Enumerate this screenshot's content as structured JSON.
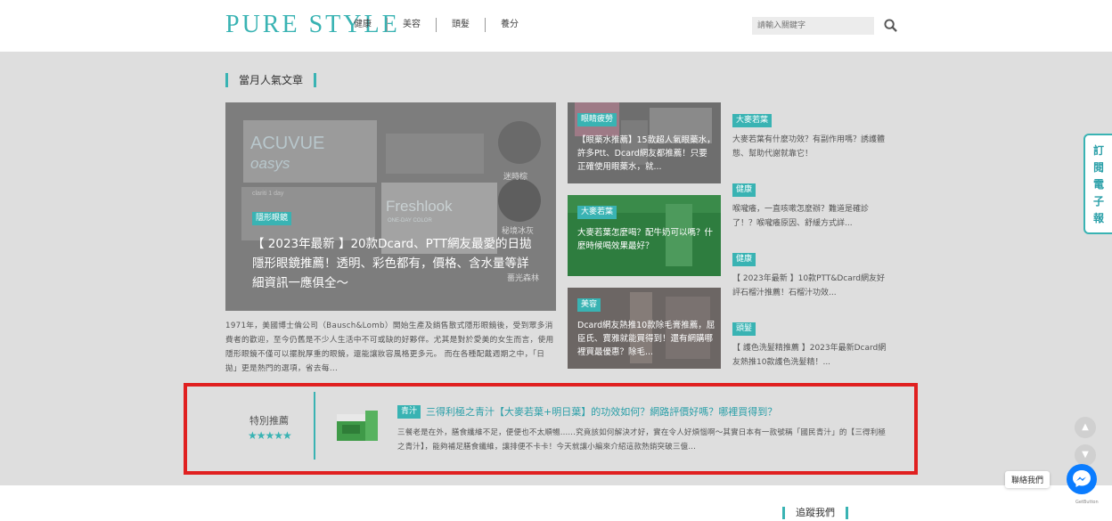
{
  "header": {
    "logo": "PURE STYLE",
    "nav": [
      "健康",
      "美容",
      "頭髮",
      "養分"
    ],
    "search_placeholder": "請輸入關鍵字"
  },
  "popular": {
    "title": "當月人氣文章",
    "hero": {
      "tag": "隱形眼鏡",
      "title": "【 2023年最新 】20款Dcard、PTT網友最愛的日拋隱形眼鏡推薦！透明、彩色都有，價格、含水量等詳細資訊一應俱全～",
      "image_text": [
        "ACUVUE",
        "oasys",
        "Freshlook",
        "ONE-DAY COLOR",
        "clariti 1 day",
        "迷時棕",
        "秘境冰灰",
        "薔光森林"
      ],
      "excerpt": "1971年，美國博士倫公司（Bausch&Lomb）開始生產及銷售散式隱形眼鏡後，受到眾多消費者的歡迎，至今仍舊是不少人生活中不可或缺的好夥伴。尤其是對於愛美的女生而言，使用隱形眼鏡不僅可以擺脫厚重的眼鏡，還能讓妝容風格更多元。 而在各種配戴週期之中，「日拋」更是熱門的選項，省去每..."
    },
    "cards": [
      {
        "tag": "眼睛疲勞",
        "title": "【眼藥水推薦】15款超人氣眼藥水，許多Ptt、Dcard網友都推薦！只要正確使用眼藥水，就..."
      },
      {
        "tag": "大麥若葉",
        "title": "大麥若葉怎麼喝？配牛奶可以嗎？什麼時候喝效果最好？"
      },
      {
        "tag": "美容",
        "title": "Dcard網友熱推10款除毛膏推薦，屈臣氏、寶雅就能買得到！還有網購哪裡買最優惠？除毛..."
      }
    ],
    "side": [
      {
        "tag": "大麥若葉",
        "title": "大麥若葉有什麼功效？有副作用嗎？誘護體態、幫助代謝就靠它！"
      },
      {
        "tag": "健康",
        "title": "喉嚨癢，一直咳嗽怎麼辦？難道是確診了！？喉嚨癢原因、舒緩方式詳..."
      },
      {
        "tag": "健康",
        "title": "【 2023年最新 】10款PTT&Dcard網友好評石榴汁推薦！石榴汁功效..."
      },
      {
        "tag": "頭髮",
        "title": "【 護色洗髮精推薦 】2023年最新Dcard網友熱推10款護色洗髮精！..."
      }
    ]
  },
  "recommend": {
    "label": "特別推薦",
    "stars": "★★★★★",
    "tag": "青汁",
    "title": "三得利極之青汁【大麥若葉+明日葉】的功效如何？網路評價好嗎？哪裡買得到？",
    "body": "三餐老是在外，膳食纖維不足，便便也不太順暢......究竟該如何解決才好，實在令人好煩惱啊～其實日本有一款號稱「國民青汁」的【三得利極之青汁】，能夠補足膳食纖維，讓排便不卡卡！今天就讓小編來介紹這款熱銷突破三億..."
  },
  "footer": {
    "follow": "追蹤我們"
  },
  "floating": {
    "subscribe": "訂閱電子報",
    "contact": "聯絡我們",
    "getbutton": "GetButton",
    "up": "▲",
    "down": "▼"
  },
  "colors": {
    "accent": "#39b3b3",
    "highlight_border": "#e02020",
    "messenger": "#0a7cff"
  }
}
